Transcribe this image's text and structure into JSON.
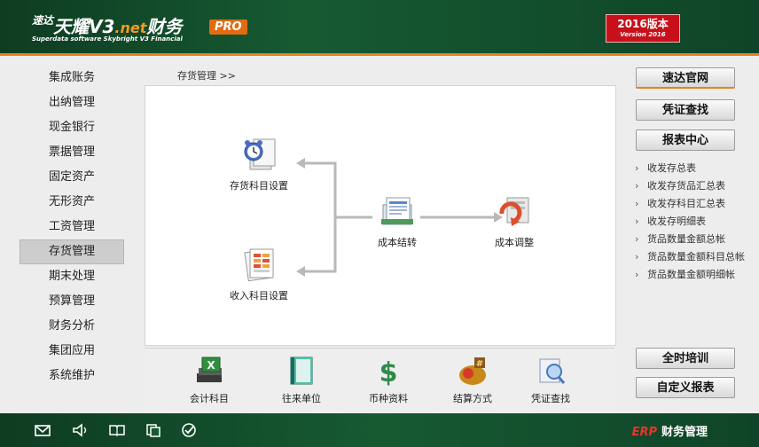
{
  "header": {
    "logo_small": "速达",
    "logo_main": "天耀V3",
    "logo_net": ".net",
    "logo_cn": "财务",
    "logo_sub": "Superdata software Skybright V3 Financial",
    "pro": "PRO",
    "version_cn": "2016版本",
    "version_en": "Version 2016"
  },
  "nav": {
    "items": [
      "集成账务",
      "出纳管理",
      "现金银行",
      "票据管理",
      "固定资产",
      "无形资产",
      "工资管理",
      "存货管理",
      "期末处理",
      "预算管理",
      "财务分析",
      "集团应用",
      "系统维护"
    ],
    "active_index": 7
  },
  "breadcrumb": "存货管理 >>",
  "flow": {
    "node1": "存货科目设置",
    "node2": "收入科目设置",
    "node3": "成本结转",
    "node4": "成本调整"
  },
  "tools": [
    "会计科目",
    "往来单位",
    "币种资料",
    "结算方式",
    "凭证查找"
  ],
  "right": {
    "btn_official": "速达官网",
    "btn_voucher": "凭证查找",
    "btn_report": "报表中心",
    "links": [
      "收发存总表",
      "收发存货品汇总表",
      "收发存科目汇总表",
      "收发存明细表",
      "货品数量金额总帐",
      "货品数量金额科目总帐",
      "货品数量金额明细帐"
    ],
    "btn_training": "全时培训",
    "btn_custom": "自定义报表"
  },
  "footer": {
    "erp": "ERP",
    "label": "财务管理"
  },
  "colors": {
    "header_green": "#165a32",
    "accent_orange": "#e98218",
    "version_red": "#c8101a"
  }
}
